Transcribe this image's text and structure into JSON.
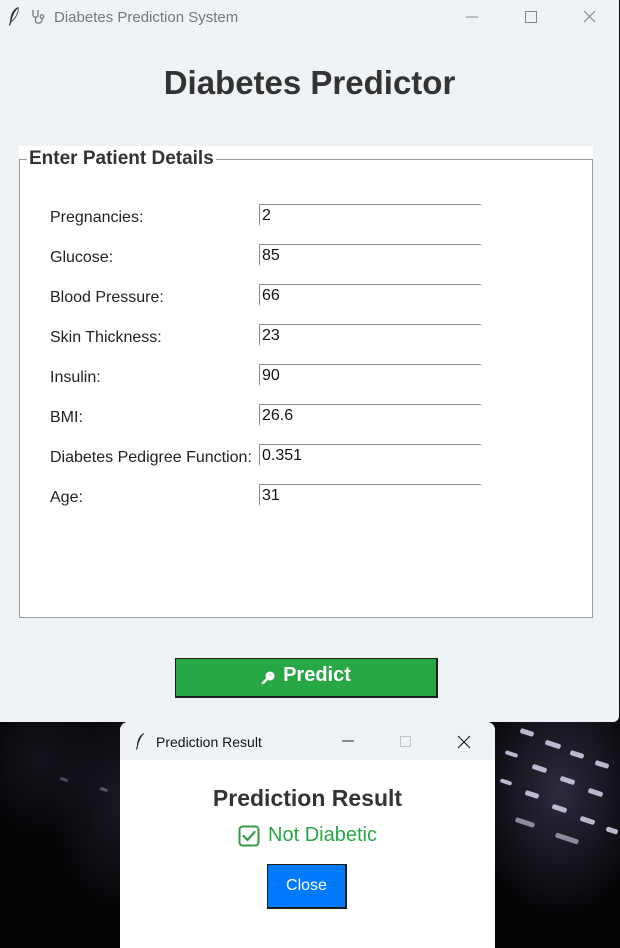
{
  "main_window": {
    "title": "Diabetes Prediction System",
    "heading": "Diabetes Predictor",
    "details_frame": {
      "legend": "Enter Patient Details",
      "fields": [
        {
          "label": "Pregnancies:",
          "value": "2"
        },
        {
          "label": "Glucose:",
          "value": "85"
        },
        {
          "label": "Blood Pressure:",
          "value": "66"
        },
        {
          "label": "Skin Thickness:",
          "value": "23"
        },
        {
          "label": "Insulin:",
          "value": "90"
        },
        {
          "label": "BMI:",
          "value": "26.6"
        },
        {
          "label": "Diabetes Pedigree Function:",
          "value": "0.351"
        },
        {
          "label": "Age:",
          "value": "31"
        }
      ]
    },
    "predict_button": {
      "label": "Predict",
      "icon": "magnifier-icon",
      "color": "#28a745"
    }
  },
  "result_window": {
    "title": "Prediction Result",
    "heading": "Prediction Result",
    "status": {
      "text": "Not Diabetic",
      "icon": "check-box-icon",
      "color": "#28a745"
    },
    "close_button": {
      "label": "Close",
      "color": "#007bff"
    }
  }
}
